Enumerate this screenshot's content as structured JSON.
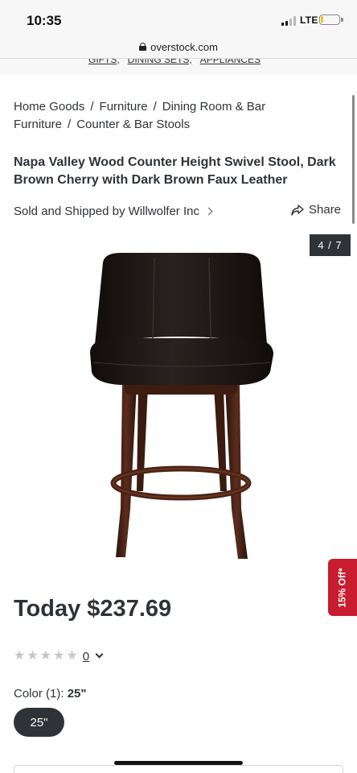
{
  "status_bar": {
    "time": "10:35",
    "network": "LTE",
    "battery_level": 0.15,
    "battery_color": "#f4c319"
  },
  "browser": {
    "url": "overstock.com"
  },
  "top_nav": {
    "links": [
      "GIFTS,",
      "DINING SETS,",
      "APPLIANCES"
    ]
  },
  "breadcrumb": {
    "items": [
      "Home Goods",
      "Furniture",
      "Dining Room & Bar Furniture",
      "Counter & Bar Stools"
    ],
    "separator": "/"
  },
  "product": {
    "title": "Napa Valley Wood Counter Height Swivel Stool, Dark Brown Cherry with Dark Brown Faux Leather",
    "seller_prefix": "Sold and Shipped by",
    "seller_name": "Willwolfer Inc",
    "share_label": "Share",
    "image_counter": "4 / 7",
    "price": "Today $237.69",
    "rating_stars": 0,
    "review_count": "0",
    "color_label": "Color (1):",
    "color_value": "25\"",
    "option_selected": "25\""
  },
  "promo": {
    "label": "15% Off*",
    "color": "#c91c2e"
  },
  "icons": {
    "lock": "lock-icon",
    "share": "share-icon",
    "seller_chevron": "chevron-right-icon",
    "rating_chevron": "chevron-down-icon"
  }
}
